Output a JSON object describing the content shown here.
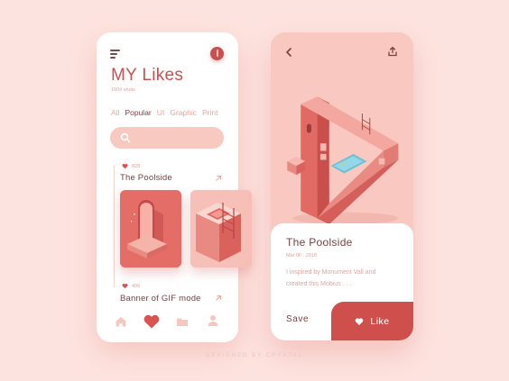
{
  "left_screen": {
    "title": "MY Likes",
    "subtitle": "1004 shots",
    "categories": [
      {
        "label": "All",
        "active": false
      },
      {
        "label": "Popular",
        "active": true
      },
      {
        "label": "UI",
        "active": false
      },
      {
        "label": "Graphic",
        "active": false
      },
      {
        "label": "Print",
        "active": false
      }
    ],
    "search": {
      "icon": "search-icon"
    },
    "feed": [
      {
        "likes": "828",
        "title": "The Poolside"
      },
      {
        "likes": "496",
        "title": "Banner of GIF mode"
      }
    ],
    "bottom_nav": [
      {
        "icon": "home-icon",
        "active": false
      },
      {
        "icon": "heart-icon",
        "active": true
      },
      {
        "icon": "folder-icon",
        "active": false
      },
      {
        "icon": "user-icon",
        "active": false
      }
    ]
  },
  "right_screen": {
    "icons": {
      "back": "chevron-left-icon",
      "share": "share-icon"
    },
    "title": "The Poolside",
    "date": "Mar 06 , 2018",
    "description": "I inspired by Monument Vall and created this Mobius . . .",
    "save_label": "Save",
    "like_label": "Like"
  },
  "colors": {
    "background": "#fde3df",
    "accent": "#c9504e",
    "accent_light": "#f8c9c1",
    "text_dark": "#7a3f3f"
  },
  "footer": "DESIGNED BY CRYSTAL"
}
